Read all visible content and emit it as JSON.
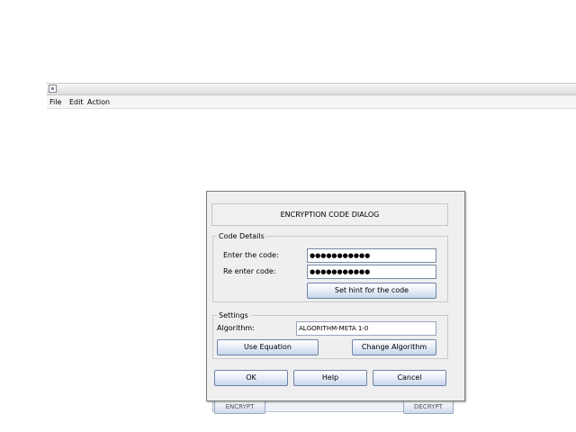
{
  "menubar": {
    "items": [
      "File",
      "Edit",
      "Action"
    ]
  },
  "background": {
    "encrypt_label": "ENCRYPT",
    "decrypt_label": "DECRYPT"
  },
  "dialog": {
    "header": "ENCRYPTION CODE DIALOG",
    "code_details": {
      "title": "Code Details",
      "enter_label": "Enter the code:",
      "enter_value": "●●●●●●●●●●●",
      "reenter_label": "Re enter code:",
      "reenter_value": "●●●●●●●●●●●",
      "hint_button": "Set hint for the code"
    },
    "settings": {
      "title": "Settings",
      "algorithm_label": "Algorithm:",
      "algorithm_value": "ALGORITHM-META 1-0",
      "use_equation": "Use Equation",
      "change_algorithm": "Change Algorithm"
    },
    "buttons": {
      "ok": "OK",
      "help": "Help",
      "cancel": "Cancel"
    }
  },
  "colors": {
    "button_border": "#6e83a8",
    "button_bottom": "#c6d4ea",
    "dialog_bg": "#efefef"
  }
}
